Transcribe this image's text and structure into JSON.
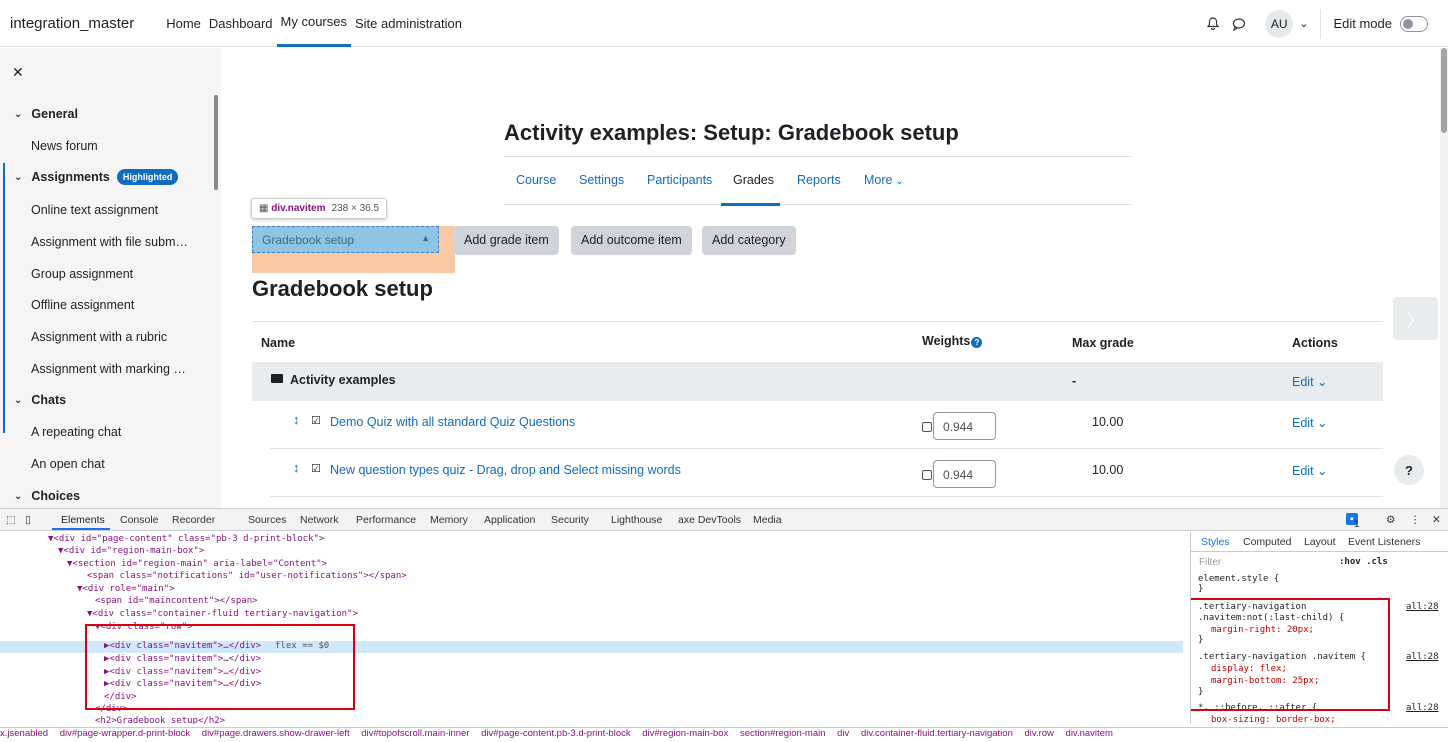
{
  "navbar": {
    "brand": "integration_master",
    "links": [
      "Home",
      "Dashboard",
      "My courses",
      "Site administration"
    ],
    "active_link": "My courses",
    "avatar_initials": "AU",
    "edit_mode_label": "Edit mode"
  },
  "drawer": {
    "items": [
      {
        "type": "section",
        "label": "General"
      },
      {
        "type": "item",
        "label": "News forum"
      },
      {
        "type": "section",
        "label": "Assignments",
        "badge": "Highlighted"
      },
      {
        "type": "item",
        "label": "Online text assignment"
      },
      {
        "type": "item",
        "label": "Assignment with file subm…"
      },
      {
        "type": "item",
        "label": "Group assignment"
      },
      {
        "type": "item",
        "label": "Offline assignment"
      },
      {
        "type": "item",
        "label": "Assignment with a rubric"
      },
      {
        "type": "item",
        "label": "Assignment with marking …"
      },
      {
        "type": "section",
        "label": "Chats"
      },
      {
        "type": "item",
        "label": "A repeating chat"
      },
      {
        "type": "item",
        "label": "An open chat"
      },
      {
        "type": "section",
        "label": "Choices"
      }
    ]
  },
  "main": {
    "page_title": "Activity examples: Setup: Gradebook setup",
    "secondary_nav": [
      "Course",
      "Settings",
      "Participants",
      "Grades",
      "Reports",
      "More"
    ],
    "active_secondary": "Grades",
    "tooltip": {
      "tag": "div.navitem",
      "dims": "238 × 36.5"
    },
    "select_value": "Gradebook setup",
    "buttons": [
      "Add grade item",
      "Add outcome item",
      "Add category"
    ],
    "heading": "Gradebook setup",
    "table": {
      "headers": [
        "Name",
        "Weights",
        "Max grade",
        "Actions"
      ],
      "category": {
        "name": "Activity examples",
        "max_grade": "-",
        "action": "Edit"
      },
      "rows": [
        {
          "name": "Demo Quiz with all standard Quiz Questions",
          "weight": "0.944",
          "max_grade": "10.00",
          "action": "Edit"
        },
        {
          "name": "New question types quiz - Drag, drop and Select missing words",
          "weight": "0.944",
          "max_grade": "10.00",
          "action": "Edit"
        }
      ]
    },
    "help_label": "?"
  },
  "devtools": {
    "tabs": [
      "Elements",
      "Console",
      "Recorder",
      "Sources",
      "Network",
      "Performance",
      "Memory",
      "Application",
      "Security",
      "Lighthouse",
      "axe DevTools",
      "Media"
    ],
    "active_tab": "Elements",
    "issues_count": "1",
    "dom_lines": [
      "▼<div id=\"page-content\" class=\"pb-3 d-print-block\">",
      "▼<div id=\"region-main-box\">",
      "▼<section id=\"region-main\" aria-label=\"Content\">",
      "<span class=\"notifications\" id=\"user-notifications\"></span>",
      "▼<div role=\"main\">",
      "<span id=\"maincontent\"></span>",
      "▼<div class=\"container-fluid tertiary-navigation\">",
      "▼<div class=\"row\">",
      "▶<div class=\"navitem\">…</div>",
      "▶<div class=\"navitem\">…</div>",
      "▶<div class=\"navitem\">…</div>",
      "▶<div class=\"navitem\">…</div>",
      "</div>",
      "</div>",
      "<h2>Gradebook setup</h2>"
    ],
    "badge_flex": "flex",
    "selected_suffix": "== $0",
    "styles_tabs": [
      "Styles",
      "Computed",
      "Layout",
      "Event Listeners"
    ],
    "filter_placeholder": "Filter",
    "filter_hints": ":hov .cls",
    "style_rules": [
      {
        "selector": "element.style {",
        "decls": [],
        "source": ""
      },
      {
        "selector": ".tertiary-navigation .navitem:not(:last-child) {",
        "decls": [
          "margin-right: 20px;"
        ],
        "source": "all:28"
      },
      {
        "selector": ".tertiary-navigation .navitem {",
        "decls": [
          "display: flex;",
          "margin-bottom: 25px;"
        ],
        "source": "all:28"
      },
      {
        "selector": "*, ::before, ::after {",
        "decls": [
          "box-sizing: border-box;"
        ],
        "source": "all:28"
      }
    ],
    "breadcrumbs": [
      "x.jsenabled",
      "div#page-wrapper.d-print-block",
      "div#page.drawers.show-drawer-left",
      "div#topofscroll.main-inner",
      "div#page-content.pb-3.d-print-block",
      "div#region-main-box",
      "section#region-main",
      "div",
      "div.container-fluid.tertiary-navigation",
      "div.row",
      "div.navitem"
    ]
  }
}
